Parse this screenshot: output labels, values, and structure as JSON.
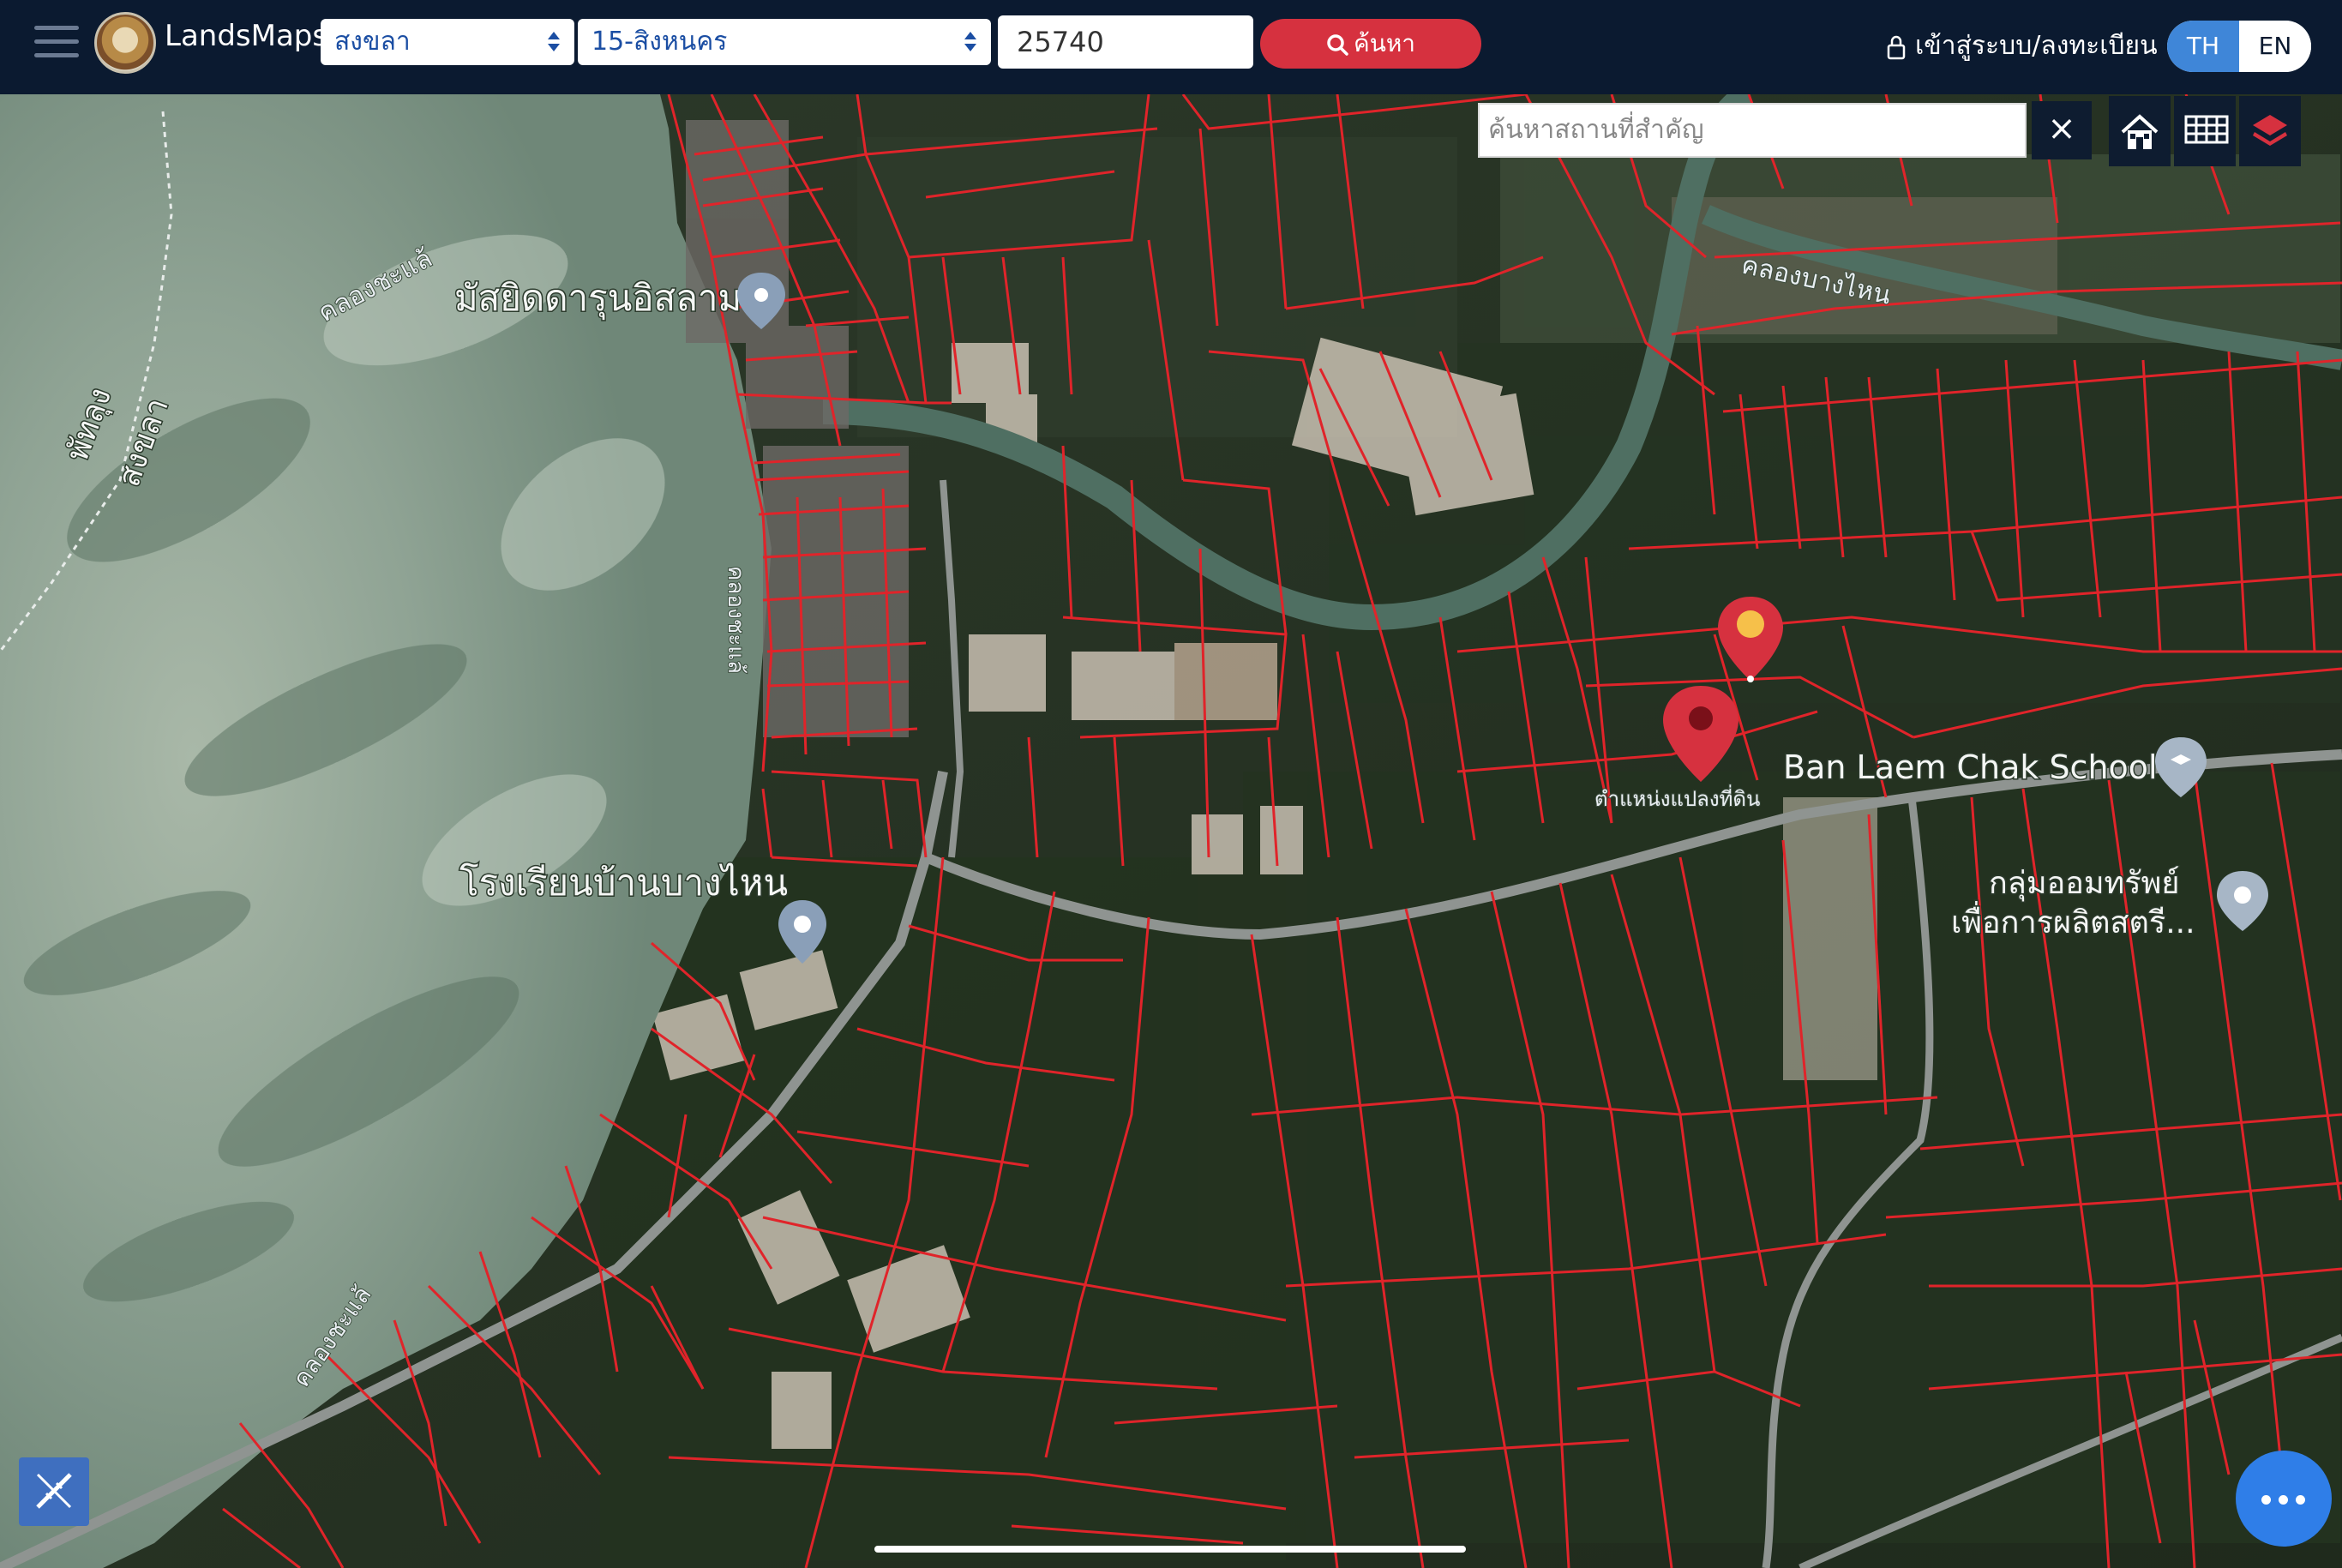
{
  "app": {
    "brand": "LandsMaps"
  },
  "header": {
    "province": "สงขลา",
    "district": "15-สิงหนคร",
    "parcel_no": "25740",
    "search_label": "ค้นหา",
    "login_label": "เข้าสู่ระบบ/ลงทะเบียน",
    "lang_th": "TH",
    "lang_en": "EN",
    "active_lang": "TH"
  },
  "map_controls": {
    "poi_placeholder": "ค้นหาสถานที่สำคัญ",
    "clear_icon": "close-icon",
    "tools": [
      "home-icon",
      "grid-icon",
      "layers-icon"
    ],
    "measure_icon": "measure-tool-icon",
    "more_icon": "more-icon"
  },
  "map_labels": {
    "mosque": "มัสยิดดารุนอิสลาม",
    "school_thai": "โรงเรียนบ้านบางไหน",
    "school_en": "Ban Laem Chak School",
    "group_line1": "กลุ่มออมทรัพย์",
    "group_line2": "เพื่อการผลิตสตรี...",
    "canal_1": "คลองชะแล้",
    "canal_2": "คลองชะแล้",
    "canal_3": "คลองชะแล้",
    "canal_4": "คลองบางไหน",
    "boundary_1": "พัทลุง",
    "boundary_2": "สงขลา",
    "pin_label": "ตำแหน่งแปลงที่ดิน"
  },
  "colors": {
    "topbar": "#0b1a30",
    "search_button": "#d6313f",
    "parcel_lines": "#e0242a",
    "lang_active": "#3f86d8",
    "fab": "#2f7ee8"
  }
}
